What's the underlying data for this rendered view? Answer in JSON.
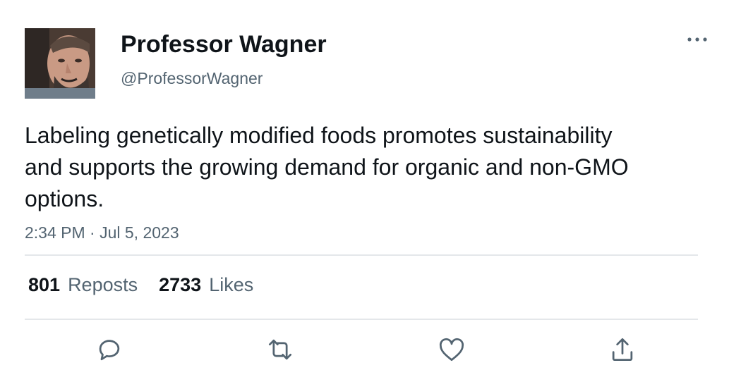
{
  "author": {
    "display_name": "Professor Wagner",
    "handle": "@ProfessorWagner",
    "avatar_icon": "profile-photo"
  },
  "tweet": {
    "text": "Labeling genetically modified foods promotes sustainability and supports the growing demand for organic and non-GMO options.",
    "timestamp": "2:34 PM · Jul 5, 2023"
  },
  "stats": {
    "reposts_count": "801",
    "reposts_label": "Reposts",
    "likes_count": "2733",
    "likes_label": "Likes"
  },
  "actions": {
    "reply_icon": "reply-icon",
    "repost_icon": "repost-icon",
    "like_icon": "heart-icon",
    "share_icon": "share-icon"
  },
  "colors": {
    "text_primary": "#0f1419",
    "text_secondary": "#536471",
    "divider": "#e4e7ea"
  }
}
